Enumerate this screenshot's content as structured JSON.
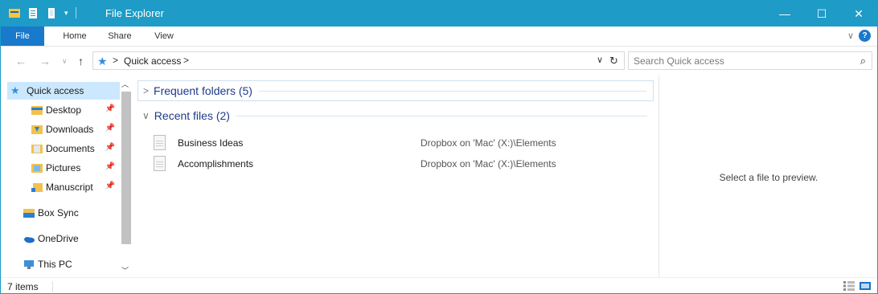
{
  "window": {
    "title": "File Explorer",
    "minimize_glyph": "—",
    "maximize_glyph": "☐",
    "close_glyph": "✕"
  },
  "qat": {
    "icons": [
      "properties-icon",
      "new-folder-icon"
    ],
    "dropdown_glyph": "▾"
  },
  "ribbon": {
    "tabs": {
      "file": "File",
      "home": "Home",
      "share": "Share",
      "view": "View"
    },
    "expand_glyph": "∨",
    "help_glyph": "?"
  },
  "navigation": {
    "back_glyph": "←",
    "forward_glyph": "→",
    "recent_glyph": "∨",
    "up_glyph": "↑"
  },
  "address": {
    "separator": ">",
    "location": "Quick access",
    "dropdown_glyph": "∨",
    "refresh_glyph": "↻"
  },
  "search": {
    "placeholder": "Search Quick access",
    "value": ""
  },
  "sidebar": {
    "items": [
      {
        "label": "Quick access",
        "selected": true,
        "pinned": false,
        "icon": "star-icon"
      },
      {
        "label": "Desktop",
        "selected": false,
        "pinned": true,
        "icon": "desktop-folder-icon"
      },
      {
        "label": "Downloads",
        "selected": false,
        "pinned": true,
        "icon": "downloads-folder-icon"
      },
      {
        "label": "Documents",
        "selected": false,
        "pinned": true,
        "icon": "documents-folder-icon"
      },
      {
        "label": "Pictures",
        "selected": false,
        "pinned": true,
        "icon": "pictures-folder-icon"
      },
      {
        "label": "Manuscript",
        "selected": false,
        "pinned": true,
        "icon": "manuscript-folder-icon"
      },
      {
        "label": "Box Sync",
        "selected": false,
        "pinned": false,
        "icon": "box-sync-icon"
      },
      {
        "label": "OneDrive",
        "selected": false,
        "pinned": false,
        "icon": "onedrive-icon"
      },
      {
        "label": "This PC",
        "selected": false,
        "pinned": false,
        "icon": "this-pc-icon"
      }
    ],
    "pin_glyph": "📌"
  },
  "content": {
    "frequent_folders": {
      "title": "Frequent folders (5)",
      "collapsed_glyph": ">"
    },
    "recent_files": {
      "title": "Recent files (2)",
      "expanded_glyph": "∨",
      "files": [
        {
          "name": "Business Ideas",
          "location": "Dropbox on 'Mac' (X:)\\Elements"
        },
        {
          "name": "Accomplishments",
          "location": "Dropbox on 'Mac' (X:)\\Elements"
        }
      ]
    }
  },
  "preview": {
    "message": "Select a file to preview."
  },
  "status": {
    "item_count": "7 items"
  },
  "colors": {
    "titlebar": "#1e9bc6",
    "file_tab": "#1979ca",
    "selection": "#cce8ff",
    "group_title": "#1e3a8a"
  }
}
